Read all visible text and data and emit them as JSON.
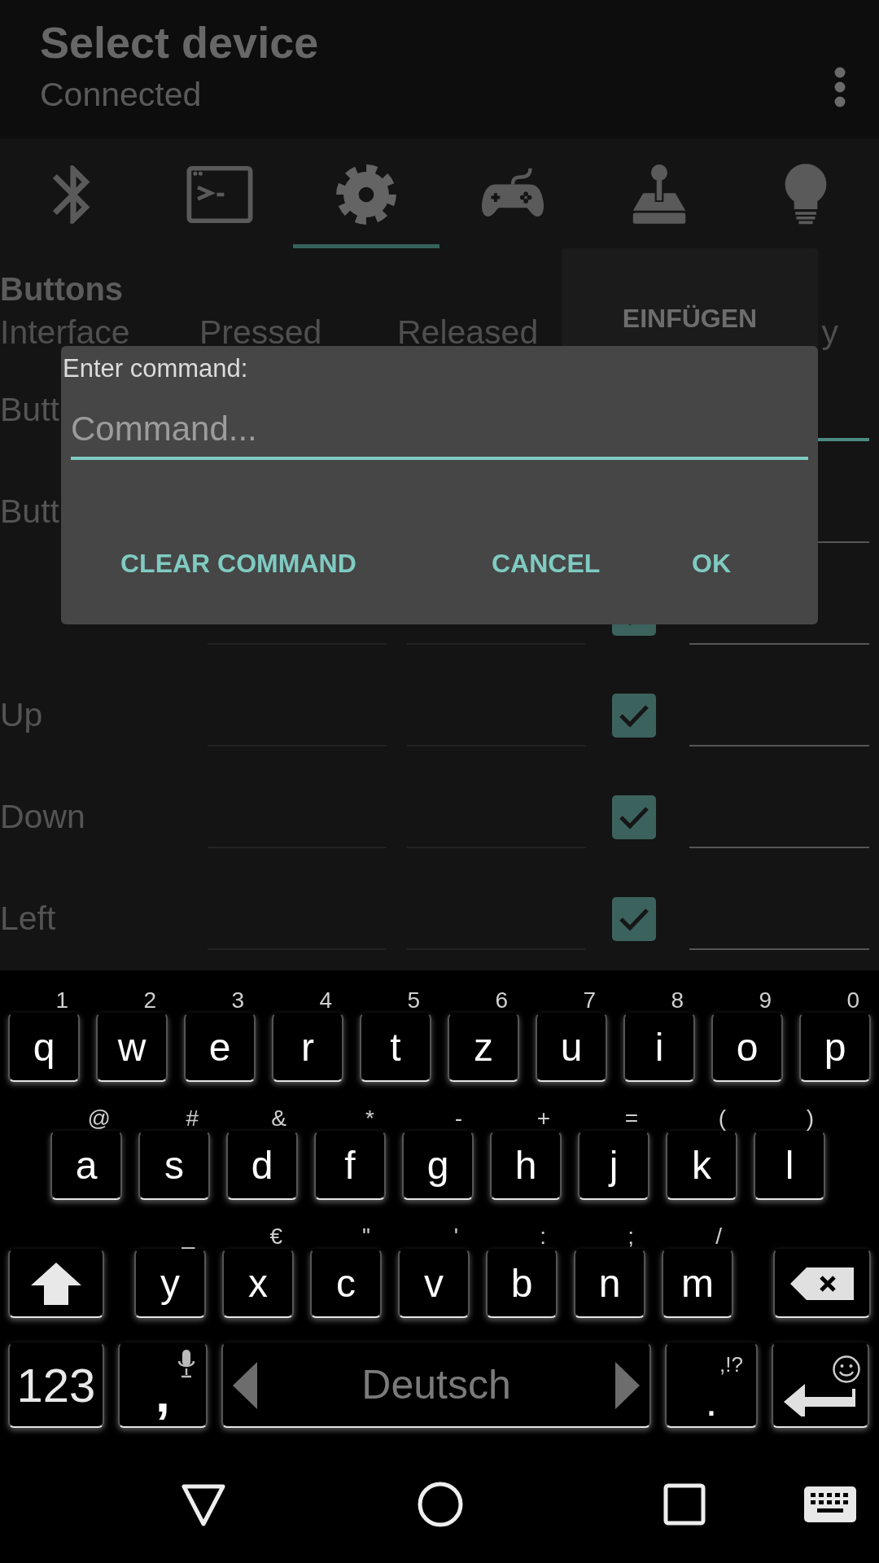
{
  "app_bar": {
    "title": "Select device",
    "subtitle": "Connected"
  },
  "tabs": [
    {
      "kind": "bluetooth",
      "selected": false
    },
    {
      "kind": "terminal",
      "selected": false
    },
    {
      "kind": "settings",
      "selected": true
    },
    {
      "kind": "gamepad",
      "selected": false
    },
    {
      "kind": "joystick",
      "selected": false
    },
    {
      "kind": "bulb",
      "selected": false
    }
  ],
  "section_title": "Buttons",
  "table": {
    "columns": [
      "Interface",
      "Pressed",
      "Released",
      "y"
    ],
    "rows": [
      {
        "label": "Butt",
        "focused": true
      },
      {
        "label": "Butt",
        "focused": false
      },
      {
        "checked": true,
        "focused": false
      },
      {
        "label": "Up",
        "checked": true,
        "focused": false
      },
      {
        "label": "Down",
        "checked": true,
        "focused": false
      },
      {
        "label": "Left",
        "checked": true,
        "focused": false
      }
    ]
  },
  "paste_popup": {
    "label": "EINFÜGEN"
  },
  "dialog": {
    "prompt": "Enter command:",
    "placeholder": "Command...",
    "buttons": [
      "CLEAR COMMAND",
      "CANCEL",
      "OK"
    ]
  },
  "keyboard": {
    "key_rows": [
      {
        "keys": [
          {
            "kind": "char",
            "label": "q",
            "hint": "1"
          },
          {
            "kind": "char",
            "label": "w",
            "hint": "2"
          },
          {
            "kind": "char",
            "label": "e",
            "hint": "3"
          },
          {
            "kind": "char",
            "label": "r",
            "hint": "4"
          },
          {
            "kind": "char",
            "label": "t",
            "hint": "5"
          },
          {
            "kind": "char",
            "label": "z",
            "hint": "6"
          },
          {
            "kind": "char",
            "label": "u",
            "hint": "7"
          },
          {
            "kind": "char",
            "label": "i",
            "hint": "8"
          },
          {
            "kind": "char",
            "label": "o",
            "hint": "9"
          },
          {
            "kind": "char",
            "label": "p",
            "hint": "0"
          }
        ]
      },
      {
        "keys": [
          {
            "kind": "char",
            "label": "a",
            "hint": "@"
          },
          {
            "kind": "char",
            "label": "s",
            "hint": "#"
          },
          {
            "kind": "char",
            "label": "d",
            "hint": "&"
          },
          {
            "kind": "char",
            "label": "f",
            "hint": "*"
          },
          {
            "kind": "char",
            "label": "g",
            "hint": "-"
          },
          {
            "kind": "char",
            "label": "h",
            "hint": "+"
          },
          {
            "kind": "char",
            "label": "j",
            "hint": "="
          },
          {
            "kind": "char",
            "label": "k",
            "hint": "("
          },
          {
            "kind": "char",
            "label": "l",
            "hint": ")"
          }
        ]
      },
      {
        "keys": [
          {
            "kind": "shift"
          },
          {
            "kind": "char",
            "label": "y",
            "hint": "_"
          },
          {
            "kind": "char",
            "label": "x",
            "hint": "€"
          },
          {
            "kind": "char",
            "label": "c",
            "hint": "\""
          },
          {
            "kind": "char",
            "label": "v",
            "hint": "'"
          },
          {
            "kind": "char",
            "label": "b",
            "hint": ":"
          },
          {
            "kind": "char",
            "label": "n",
            "hint": ";"
          },
          {
            "kind": "char",
            "label": "m",
            "hint": "/"
          },
          {
            "kind": "backspace"
          }
        ]
      },
      {
        "keys": [
          {
            "kind": "symbols",
            "label": "123"
          },
          {
            "kind": "comma",
            "label": ","
          },
          {
            "kind": "space",
            "label": "Deutsch"
          },
          {
            "kind": "period",
            "label": ".",
            "hint": ",!?"
          },
          {
            "kind": "enter"
          }
        ]
      }
    ]
  }
}
